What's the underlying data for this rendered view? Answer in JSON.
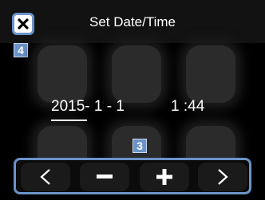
{
  "header": {
    "title": "Set Date/Time",
    "close_icon": "close-icon"
  },
  "badges": {
    "close_marker": "4",
    "controls_marker": "3"
  },
  "datetime": {
    "date": "2015- 1 - 1",
    "time": "1 :44",
    "selected_field": "year"
  },
  "controls": {
    "prev_icon": "chevron-left-icon",
    "minus_icon": "minus-icon",
    "plus_icon": "plus-icon",
    "next_icon": "chevron-right-icon"
  },
  "colors": {
    "accent": "#6b93c9",
    "background": "#000000",
    "text": "#ffffff"
  }
}
